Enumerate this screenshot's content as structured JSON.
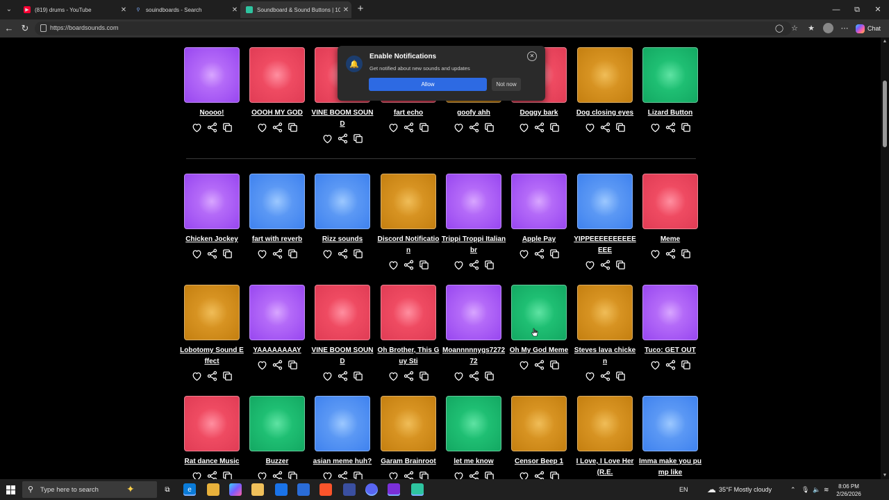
{
  "browser": {
    "tabs": [
      {
        "title": "(819) drums - YouTube",
        "icon": "youtube-icon",
        "color": "#ff0033"
      },
      {
        "title": "souindboards - Search",
        "icon": "search-icon",
        "color": "#3b82f6"
      },
      {
        "title": "Soundboard & Sound Buttons | 10",
        "icon": "boardsounds-icon",
        "color": "#2ec4a0"
      }
    ],
    "url": "https://boardsounds.com",
    "chat_label": "Chat"
  },
  "notification": {
    "title": "Enable Notifications",
    "subtitle": "Get notified about new sounds and updates",
    "allow_label": "Allow",
    "notnow_label": "Not now"
  },
  "rows": [
    {
      "cards": [
        {
          "title": "Noooo!",
          "color": "purple"
        },
        {
          "title": "OOOH MY GOD",
          "color": "red"
        },
        {
          "title": "VINE BOOM SOUND",
          "color": "red"
        },
        {
          "title": "fart echo",
          "color": "red"
        },
        {
          "title": "goofy ahh",
          "color": "orange"
        },
        {
          "title": "Doggy bark",
          "color": "red"
        },
        {
          "title": "Dog closing eyes",
          "color": "orange"
        },
        {
          "title": "Lizard Button",
          "color": "green"
        }
      ]
    },
    {
      "cards": [
        {
          "title": "Chicken Jockey",
          "color": "purple"
        },
        {
          "title": "fart with reverb",
          "color": "blue"
        },
        {
          "title": "Rizz sounds",
          "color": "blue"
        },
        {
          "title": "Discord Notification",
          "color": "orange"
        },
        {
          "title": "Trippi Troppi Italian br",
          "color": "purple"
        },
        {
          "title": "Apple Pay",
          "color": "purple"
        },
        {
          "title": "YIPPEEEEEEEEEEEEE",
          "color": "blue"
        },
        {
          "title": "Meme",
          "color": "red"
        }
      ]
    },
    {
      "cards": [
        {
          "title": "Lobotomy Sound Effect",
          "color": "orange"
        },
        {
          "title": "YAAAAAAAAY",
          "color": "purple"
        },
        {
          "title": "VINE BOOM SOUND",
          "color": "red"
        },
        {
          "title": "Oh Brother, This Guy Sti",
          "color": "red"
        },
        {
          "title": "Moannnnnygs727272",
          "color": "purple"
        },
        {
          "title": "Oh My God Meme",
          "color": "green"
        },
        {
          "title": "Steves lava chicken",
          "color": "orange"
        },
        {
          "title": "Tuco: GET OUT",
          "color": "purple"
        }
      ]
    },
    {
      "cards": [
        {
          "title": "Rat dance Music",
          "color": "red"
        },
        {
          "title": "Buzzer",
          "color": "green"
        },
        {
          "title": "asian meme huh?",
          "color": "blue"
        },
        {
          "title": "Garam Brainroot",
          "color": "orange"
        },
        {
          "title": "let me know",
          "color": "green"
        },
        {
          "title": "Censor Beep 1",
          "color": "orange"
        },
        {
          "title": "I Love, I Love Her (R.E.",
          "color": "orange"
        },
        {
          "title": "Imma make you pump like",
          "color": "blue"
        }
      ]
    }
  ],
  "taskbar": {
    "search_placeholder": "Type here to search",
    "weather": "35°F  Mostly cloudy",
    "lang": "EN",
    "time": "8:06 PM",
    "date": "2/26/2026"
  }
}
